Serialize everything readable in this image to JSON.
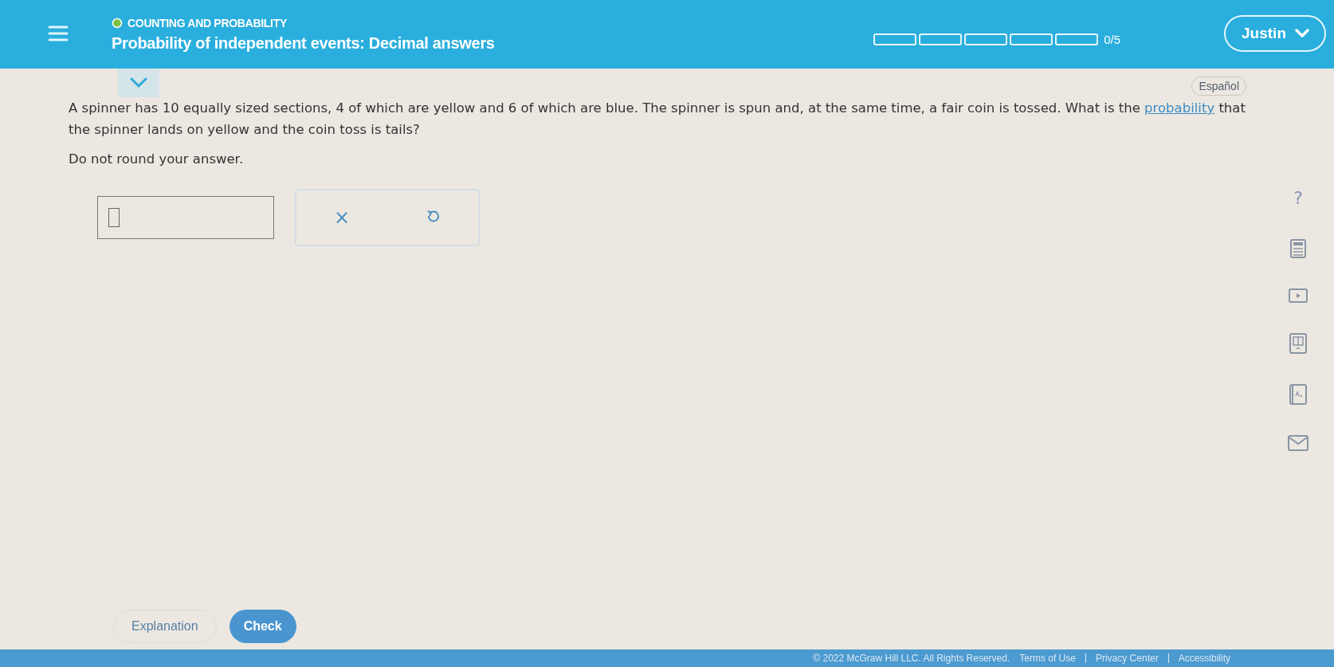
{
  "header": {
    "topic": "COUNTING AND PROBABILITY",
    "title": "Probability of independent events: Decimal answers",
    "progress": {
      "segments": [
        {
          "filled": false
        },
        {
          "filled": false
        },
        {
          "filled": false
        },
        {
          "filled": false
        },
        {
          "filled": false
        }
      ],
      "count": "0/5"
    },
    "user": "Justin"
  },
  "language_button": "Español",
  "question": {
    "before": "A spinner has 10 equally sized sections, 4 of which are yellow and 6 of which are blue. The spinner is spun and, at the same time, a fair coin is tossed. What is the",
    "link": "probability",
    "after": "that the spinner lands on yellow and the coin toss is tails?",
    "instruction": "Do not round your answer."
  },
  "answer_tools": [
    {
      "kind": "clear",
      "label": "×"
    },
    {
      "kind": "undo"
    }
  ],
  "side_tools": [
    {
      "kind": "help",
      "label": "?"
    },
    {
      "kind": "calculator"
    },
    {
      "kind": "video"
    },
    {
      "kind": "ebook"
    },
    {
      "kind": "dictionary"
    },
    {
      "kind": "message"
    }
  ],
  "buttons": {
    "explanation": "Explanation",
    "check": "Check"
  },
  "footer": {
    "copyright": "© 2022 McGraw Hill LLC. All Rights Reserved.",
    "links": [
      "Terms of Use",
      "Privacy Center",
      "Accessibility"
    ]
  }
}
